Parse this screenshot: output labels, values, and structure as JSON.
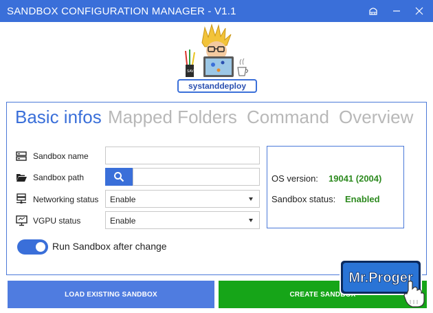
{
  "window": {
    "title": "SANDBOX CONFIGURATION MANAGER - V1.1",
    "controls": {
      "hat_icon": "hat-icon",
      "minimize_icon": "minimize-icon",
      "close_icon": "close-icon"
    }
  },
  "logo": {
    "text": "systanddeploy"
  },
  "tabs": [
    {
      "label": "Basic infos",
      "active": true
    },
    {
      "label": "Mapped Folders",
      "active": false
    },
    {
      "label": "Command",
      "active": false
    },
    {
      "label": "Overview",
      "active": false
    }
  ],
  "form": {
    "sandbox_name": {
      "label": "Sandbox name",
      "value": "",
      "icon": "server-icon"
    },
    "sandbox_path": {
      "label": "Sandbox path",
      "value": "",
      "icon": "folder-open-icon",
      "browse_icon": "search-icon"
    },
    "networking": {
      "label": "Networking status",
      "value": "Enable",
      "icon": "network-icon"
    },
    "vgpu": {
      "label": "VGPU status",
      "value": "Enable",
      "icon": "monitor-icon"
    }
  },
  "info": {
    "os_label": "OS version:",
    "os_value": "19041 (2004)",
    "status_label": "Sandbox status:",
    "status_value": "Enabled"
  },
  "toggle": {
    "label": "Run Sandbox after change",
    "on": true
  },
  "buttons": {
    "load": "LOAD EXISTING SANDBOX",
    "create": "CREATE SANDBOX"
  },
  "watermark": {
    "text": "Mr.Proger"
  },
  "colors": {
    "accent": "#3a6fd9",
    "green_button": "#16a518",
    "status_green": "#2d8a1f",
    "tab_inactive": "#b8b8b8"
  }
}
